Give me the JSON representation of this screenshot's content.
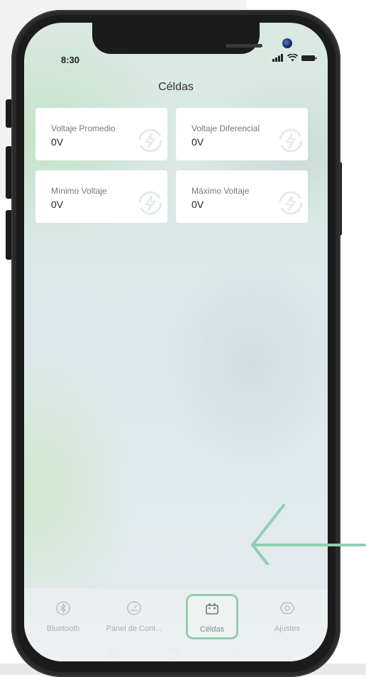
{
  "status_bar": {
    "time": "8:30"
  },
  "header": {
    "title": "Céldas"
  },
  "cards": [
    {
      "label": "Voltaje Promedio",
      "value": "0V"
    },
    {
      "label": "Voltaje Diferencial",
      "value": "0V"
    },
    {
      "label": "Mínimo Voltaje",
      "value": "0V"
    },
    {
      "label": "Máximo Voltaje",
      "value": "0V"
    }
  ],
  "tabs": [
    {
      "label": "Bluetooth",
      "icon": "bluetooth-icon",
      "active": false
    },
    {
      "label": "Panel de Cont...",
      "icon": "gauge-icon",
      "active": false
    },
    {
      "label": "Céldas",
      "icon": "battery-icon",
      "active": true
    },
    {
      "label": "Ajustes",
      "icon": "settings-icon",
      "active": false
    }
  ],
  "colors": {
    "highlight": "#8fcfb0",
    "arrow": "#8fcfb0",
    "card_background": "#ffffff",
    "inactive_tab_text": "#a7b1b4"
  }
}
